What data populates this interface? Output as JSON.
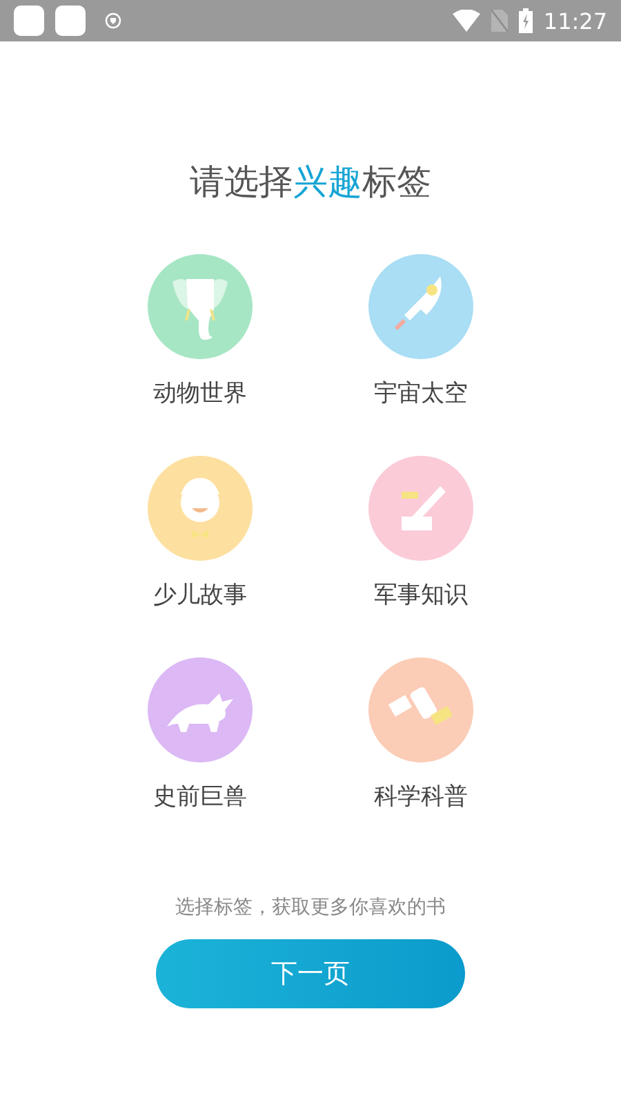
{
  "status_bar": {
    "time": "11:27"
  },
  "title": {
    "before": "请选择",
    "highlight": "兴趣",
    "after": "标签"
  },
  "topics": [
    {
      "label": "动物世界",
      "kind": "elephant",
      "color": "#a6e6c4"
    },
    {
      "label": "宇宙太空",
      "kind": "rocket",
      "color": "#a9def4"
    },
    {
      "label": "少儿故事",
      "kind": "boy",
      "color": "#fde0a0"
    },
    {
      "label": "军事知识",
      "kind": "cannon",
      "color": "#fbcbd8"
    },
    {
      "label": "史前巨兽",
      "kind": "dinosaur",
      "color": "#dcb8f5"
    },
    {
      "label": "科学科普",
      "kind": "satellite",
      "color": "#fbccb6"
    }
  ],
  "hint": "选择标签，获取更多你喜欢的书",
  "next_button": "下一页"
}
